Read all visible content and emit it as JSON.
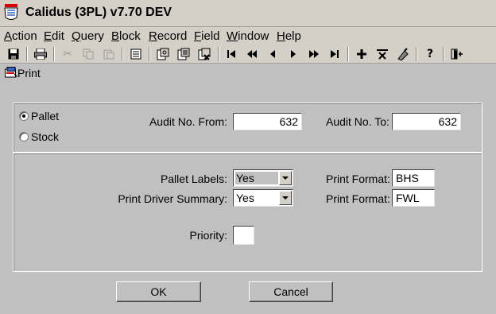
{
  "window": {
    "title": "Calidus (3PL) v7.70 DEV"
  },
  "menu": [
    {
      "label": "Action",
      "accel": "A",
      "rest": "ction"
    },
    {
      "label": "Edit",
      "accel": "E",
      "rest": "dit"
    },
    {
      "label": "Query",
      "accel": "Q",
      "rest": "uery"
    },
    {
      "label": "Block",
      "accel": "B",
      "rest": "lock"
    },
    {
      "label": "Record",
      "accel": "R",
      "rest": "ecord"
    },
    {
      "label": "Field",
      "accel": "F",
      "rest": "ield"
    },
    {
      "label": "Window",
      "accel": "W",
      "rest": "indow"
    },
    {
      "label": "Help",
      "accel": "H",
      "rest": "elp"
    }
  ],
  "toolbar": {
    "icons": [
      "save-icon",
      "print-icon",
      "cut-icon",
      "copy-icon",
      "paste-icon",
      "list-icon",
      "enter-query-icon",
      "execute-query-icon",
      "cancel-query-icon",
      "first-record-icon",
      "previous-block-icon",
      "previous-record-icon",
      "next-record-icon",
      "next-block-icon",
      "last-record-icon",
      "insert-record-icon",
      "delete-record-icon",
      "clear-record-icon",
      "help-icon",
      "exit-icon"
    ]
  },
  "form": {
    "title": "Print",
    "selection": {
      "options": [
        "Pallet",
        "Stock"
      ],
      "selected": "Pallet"
    },
    "audit_from_label": "Audit No. From:",
    "audit_from_value": "632",
    "audit_to_label": "Audit No. To:",
    "audit_to_value": "632",
    "pallet_labels_label": "Pallet Labels:",
    "pallet_labels_value": "Yes",
    "print_format_1_label": "Print Format:",
    "print_format_1_value": "BHS",
    "driver_summary_label": "Print Driver Summary:",
    "driver_summary_value": "Yes",
    "print_format_2_label": "Print Format:",
    "print_format_2_value": "FWL",
    "priority_label": "Priority:",
    "priority_value": "",
    "ok_label": "OK",
    "cancel_label": "Cancel"
  }
}
